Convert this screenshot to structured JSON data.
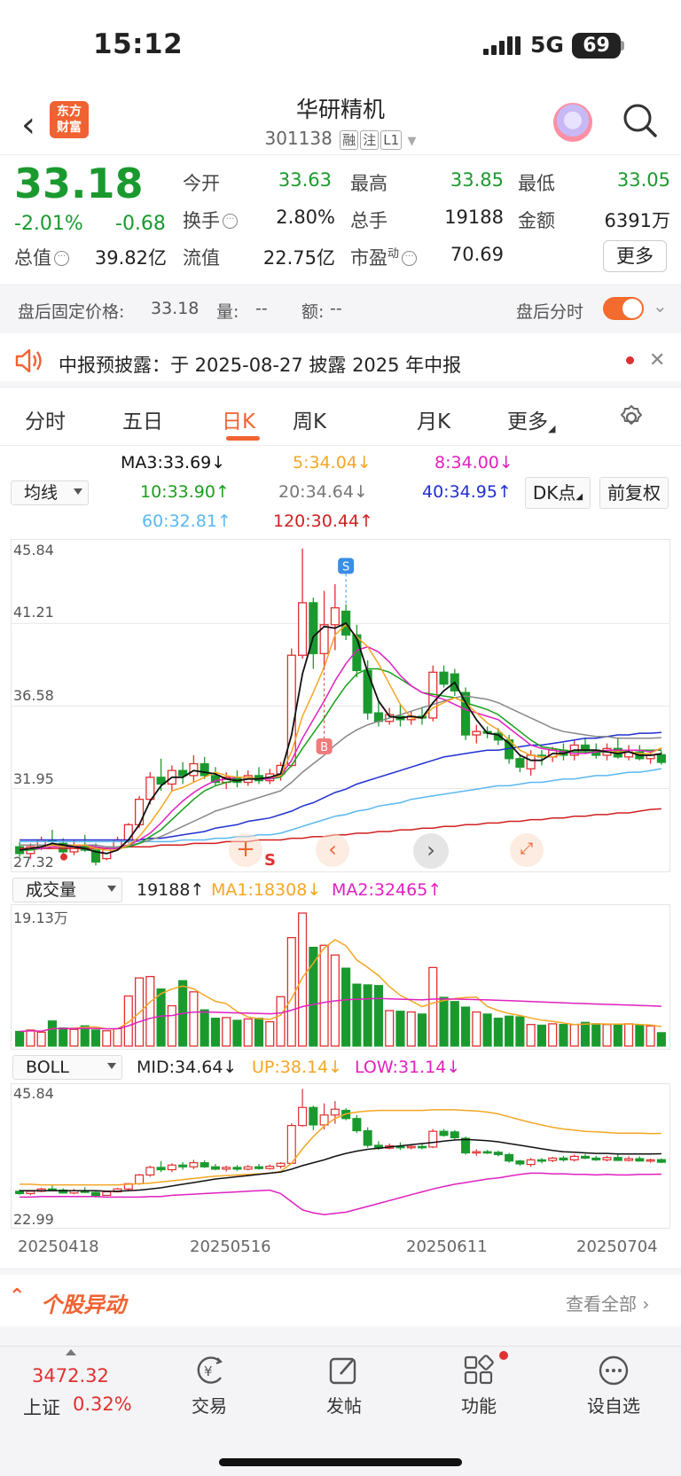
{
  "status_bar": {
    "time": "15:12",
    "network": "5G",
    "battery": "69"
  },
  "header": {
    "logo_text_1": "东方",
    "logo_text_2": "财富",
    "title": "华研精机",
    "code": "301138",
    "tags": [
      "融",
      "注",
      "L1"
    ]
  },
  "quote": {
    "price": "33.18",
    "change_pct": "-2.01%",
    "change": "-0.68",
    "open_label": "今开",
    "open": "33.63",
    "high_label": "最高",
    "high": "33.85",
    "low_label": "最低",
    "low": "33.05",
    "turnover_label": "换手",
    "turnover": "2.80%",
    "volume_label": "总手",
    "volume": "19188",
    "amount_label": "金额",
    "amount": "6391万",
    "mktcap_label": "总值",
    "mktcap": "39.82亿",
    "float_label": "流值",
    "float": "22.75亿",
    "pe_label": "市盈",
    "pe_sup": "动",
    "pe": "70.69",
    "more": "更多"
  },
  "after_hours": {
    "price_label": "盘后固定价格:",
    "price": "33.18",
    "vol_label": "量:",
    "vol": "--",
    "amt_label": "额:",
    "amt": "--",
    "toggle_label": "盘后分时",
    "toggle_on": true
  },
  "notice": {
    "text": "中报预披露：于 2025-08-27 披露 2025 年中报"
  },
  "tabs": [
    "分时",
    "五日",
    "日K",
    "周K",
    "月K",
    "更多"
  ],
  "active_tab": "日K",
  "ma_legend": {
    "selector": "均线",
    "ma3": "MA3:33.69",
    "ma5": "5:34.04",
    "ma8": "8:34.00",
    "ma10": "10:33.90",
    "ma20": "20:34.64",
    "ma40": "40:34.95",
    "ma60": "60:32.81",
    "ma120": "120:30.44",
    "dk_button": "DK点",
    "adjust_button": "前复权"
  },
  "price_axis": [
    "45.84",
    "41.21",
    "36.58",
    "31.95",
    "27.32"
  ],
  "volume_legend": {
    "selector": "成交量",
    "vol": "19188",
    "ma1": "MA1:18308",
    "ma2": "MA2:32465",
    "max": "19.13万"
  },
  "boll_legend": {
    "selector": "BOLL",
    "mid": "MID:34.64",
    "up": "UP:38.14",
    "low": "LOW:31.14",
    "top": "45.84",
    "bottom": "22.99"
  },
  "dates": [
    "20250418",
    "20250516",
    "20250611",
    "20250704"
  ],
  "markers": {
    "buy": "B",
    "sell": "S",
    "s_small": "S"
  },
  "stock_move": {
    "title": "个股异动",
    "see_all": "查看全部"
  },
  "bottom_nav": {
    "index_value": "3472.32",
    "index_name": "上证",
    "index_pct": "0.32%",
    "trade": "交易",
    "post": "发帖",
    "functions": "功能",
    "watchlist": "设自选"
  },
  "colors": {
    "up": "#e03030",
    "down": "#1a9a2e",
    "accent": "#f06232",
    "ma3": "#111111",
    "ma5": "#f5a623",
    "ma8": "#e020c0",
    "ma10": "#1aa01a",
    "ma20": "#888888",
    "ma40": "#2030d0",
    "ma60": "#5ab8f0",
    "ma120": "#d02020"
  },
  "chart_data": {
    "type": "candlestick",
    "title": "",
    "ylim": [
      27.32,
      45.84
    ],
    "x_ticks": [
      "20250418",
      "20250516",
      "20250611",
      "20250704"
    ],
    "candles": [
      [
        28.2,
        28.5,
        27.6,
        27.8
      ],
      [
        27.8,
        28.4,
        27.5,
        28.2
      ],
      [
        28.2,
        28.8,
        28.0,
        28.6
      ],
      [
        28.6,
        29.2,
        28.3,
        28.5
      ],
      [
        28.4,
        28.7,
        27.8,
        27.9
      ],
      [
        27.9,
        28.6,
        27.7,
        28.3
      ],
      [
        28.3,
        28.9,
        27.9,
        28.0
      ],
      [
        28.0,
        28.4,
        27.1,
        27.3
      ],
      [
        27.5,
        28.2,
        27.4,
        28.1
      ],
      [
        28.1,
        28.8,
        28.0,
        28.6
      ],
      [
        28.6,
        29.6,
        28.4,
        29.5
      ],
      [
        29.5,
        31.2,
        29.3,
        31.0
      ],
      [
        31.0,
        32.6,
        30.7,
        32.3
      ],
      [
        32.3,
        33.4,
        31.5,
        31.9
      ],
      [
        31.9,
        33.0,
        31.5,
        32.7
      ],
      [
        32.7,
        33.2,
        31.9,
        32.4
      ],
      [
        32.4,
        33.6,
        32.0,
        33.1
      ],
      [
        33.1,
        33.5,
        32.2,
        32.4
      ],
      [
        32.4,
        32.9,
        31.8,
        32.0
      ],
      [
        32.0,
        32.6,
        31.6,
        32.3
      ],
      [
        32.3,
        32.7,
        31.7,
        32.0
      ],
      [
        32.0,
        32.7,
        31.8,
        32.4
      ],
      [
        32.4,
        32.9,
        31.9,
        32.1
      ],
      [
        32.1,
        32.8,
        31.9,
        32.5
      ],
      [
        32.5,
        33.2,
        32.1,
        33.0
      ],
      [
        33.0,
        39.9,
        32.9,
        39.5
      ],
      [
        39.5,
        45.8,
        39.3,
        42.6
      ],
      [
        42.6,
        42.9,
        38.7,
        39.6
      ],
      [
        39.6,
        43.3,
        38.8,
        41.3
      ],
      [
        41.3,
        43.7,
        39.8,
        42.3
      ],
      [
        42.1,
        42.5,
        40.4,
        40.7
      ],
      [
        40.7,
        41.3,
        38.2,
        38.6
      ],
      [
        38.6,
        39.2,
        35.7,
        36.1
      ],
      [
        36.1,
        36.8,
        35.3,
        35.6
      ],
      [
        35.6,
        36.4,
        35.4,
        36.0
      ],
      [
        35.9,
        36.6,
        35.3,
        35.7
      ],
      [
        35.7,
        36.2,
        35.4,
        35.9
      ],
      [
        35.9,
        36.4,
        35.4,
        35.8
      ],
      [
        35.8,
        38.9,
        35.6,
        38.5
      ],
      [
        38.5,
        38.9,
        37.6,
        37.8
      ],
      [
        38.4,
        38.7,
        37.1,
        37.4
      ],
      [
        37.3,
        37.6,
        34.5,
        34.8
      ],
      [
        34.8,
        35.4,
        34.3,
        35.0
      ],
      [
        35.0,
        35.3,
        34.6,
        34.9
      ],
      [
        34.9,
        35.2,
        34.2,
        34.5
      ],
      [
        34.5,
        34.8,
        33.1,
        33.4
      ],
      [
        33.4,
        33.6,
        32.6,
        32.9
      ],
      [
        32.8,
        33.9,
        32.4,
        33.6
      ],
      [
        33.6,
        33.9,
        33.0,
        33.5
      ],
      [
        33.5,
        34.1,
        33.2,
        33.9
      ],
      [
        33.9,
        34.3,
        33.3,
        33.6
      ],
      [
        33.6,
        34.5,
        33.3,
        34.2
      ],
      [
        34.2,
        34.6,
        33.7,
        33.9
      ],
      [
        33.9,
        34.3,
        33.4,
        33.6
      ],
      [
        33.6,
        34.3,
        33.3,
        34.0
      ],
      [
        34.0,
        34.6,
        33.4,
        33.5
      ],
      [
        33.5,
        34.2,
        33.3,
        33.8
      ],
      [
        33.8,
        34.2,
        33.3,
        33.4
      ],
      [
        33.4,
        33.8,
        33.1,
        33.6
      ],
      [
        33.63,
        33.85,
        33.05,
        33.18
      ]
    ],
    "volumes": [
      2.1,
      2.3,
      2.0,
      3.6,
      2.6,
      2.4,
      2.9,
      2.3,
      2.2,
      2.5,
      7.2,
      9.8,
      10.0,
      8.2,
      5.8,
      9.4,
      7.8,
      5.2,
      4.0,
      4.1,
      3.7,
      3.9,
      4.0,
      3.5,
      7.1,
      15.6,
      19.13,
      14.2,
      14.5,
      13.1,
      11.2,
      8.9,
      8.8,
      8.7,
      5.1,
      5.0,
      4.9,
      4.6,
      11.3,
      7.0,
      6.4,
      5.6,
      4.9,
      4.6,
      4.0,
      4.3,
      4.2,
      3.1,
      3.0,
      3.2,
      3.1,
      3.1,
      3.4,
      3.2,
      3.1,
      3.0,
      3.2,
      3.0,
      2.9,
      1.92
    ],
    "ma_series": {
      "ma3": [
        28.0,
        28.1,
        28.2,
        28.4,
        28.3,
        28.2,
        28.1,
        27.9,
        27.8,
        28.0,
        28.6,
        29.5,
        30.9,
        31.8,
        32.3,
        32.3,
        32.7,
        32.6,
        32.5,
        32.2,
        32.1,
        32.2,
        32.2,
        32.3,
        32.5,
        34.8,
        38.4,
        40.6,
        41.2,
        41.1,
        41.4,
        40.5,
        38.5,
        36.8,
        35.9,
        35.8,
        35.9,
        35.8,
        36.7,
        37.4,
        37.9,
        36.7,
        35.7,
        34.9,
        34.8,
        34.3,
        33.6,
        33.3,
        33.3,
        33.7,
        33.7,
        33.9,
        33.9,
        33.9,
        33.8,
        33.7,
        33.8,
        33.6,
        33.6,
        33.69
      ],
      "ma5": [
        28.0,
        28.1,
        28.2,
        28.3,
        28.2,
        28.3,
        28.3,
        28.1,
        28.0,
        28.0,
        28.3,
        28.8,
        29.6,
        30.5,
        31.5,
        31.7,
        32.0,
        32.3,
        32.6,
        32.4,
        32.3,
        32.3,
        32.2,
        32.3,
        32.4,
        33.8,
        35.9,
        37.3,
        38.8,
        40.7,
        41.3,
        40.6,
        40.0,
        39.0,
        37.8,
        36.6,
        35.8,
        35.8,
        36.4,
        36.7,
        37.0,
        36.7,
        36.1,
        35.5,
        35.1,
        34.5,
        33.9,
        33.6,
        33.5,
        33.5,
        33.7,
        33.9,
        33.9,
        33.9,
        33.8,
        33.8,
        33.8,
        33.7,
        33.7,
        34.04
      ],
      "ma8": [
        28.0,
        28.1,
        28.1,
        28.2,
        28.2,
        28.2,
        28.3,
        28.2,
        28.1,
        28.1,
        28.3,
        28.6,
        29.0,
        29.6,
        30.3,
        30.9,
        31.4,
        31.8,
        32.1,
        32.2,
        32.3,
        32.3,
        32.2,
        32.2,
        32.4,
        33.3,
        34.6,
        35.7,
        36.8,
        38.0,
        39.0,
        39.8,
        40.0,
        39.7,
        39.1,
        38.3,
        37.7,
        37.3,
        37.1,
        36.9,
        36.6,
        36.3,
        36.1,
        35.9,
        35.7,
        35.2,
        34.7,
        34.2,
        34.0,
        33.9,
        33.8,
        33.7,
        33.7,
        33.8,
        33.9,
        33.9,
        33.9,
        33.9,
        33.8,
        34.0
      ],
      "ma10": [
        28.0,
        28.0,
        28.1,
        28.2,
        28.2,
        28.2,
        28.2,
        28.2,
        28.1,
        28.1,
        28.2,
        28.4,
        28.8,
        29.2,
        29.8,
        30.4,
        31.0,
        31.5,
        31.8,
        32.0,
        32.1,
        32.2,
        32.2,
        32.2,
        32.3,
        33.0,
        34.0,
        34.9,
        35.8,
        36.8,
        37.7,
        38.4,
        38.7,
        38.7,
        38.5,
        38.1,
        37.7,
        37.3,
        37.2,
        37.1,
        37.0,
        36.7,
        36.5,
        36.3,
        36.0,
        35.5,
        35.0,
        34.5,
        34.1,
        34.0,
        33.9,
        33.8,
        33.8,
        33.8,
        33.8,
        33.8,
        33.9,
        33.9,
        33.9,
        33.9
      ],
      "ma20": [
        28.3,
        28.3,
        28.3,
        28.3,
        28.3,
        28.3,
        28.3,
        28.3,
        28.2,
        28.2,
        28.3,
        28.4,
        28.6,
        28.8,
        29.1,
        29.4,
        29.7,
        30.0,
        30.3,
        30.5,
        30.7,
        30.9,
        31.1,
        31.3,
        31.5,
        32.0,
        32.6,
        33.1,
        33.6,
        34.2,
        34.7,
        35.1,
        35.4,
        35.6,
        35.8,
        36.0,
        36.2,
        36.4,
        36.6,
        36.8,
        37.0,
        37.1,
        37.0,
        36.9,
        36.7,
        36.4,
        36.1,
        35.8,
        35.5,
        35.2,
        35.0,
        34.9,
        34.8,
        34.7,
        34.7,
        34.6,
        34.6,
        34.6,
        34.6,
        34.64
      ],
      "ma40": [
        28.6,
        28.6,
        28.6,
        28.6,
        28.6,
        28.6,
        28.6,
        28.6,
        28.6,
        28.6,
        28.6,
        28.6,
        28.7,
        28.7,
        28.8,
        28.9,
        29.0,
        29.1,
        29.3,
        29.4,
        29.5,
        29.7,
        29.8,
        29.9,
        30.1,
        30.3,
        30.6,
        30.8,
        31.1,
        31.4,
        31.6,
        31.9,
        32.1,
        32.3,
        32.5,
        32.7,
        32.9,
        33.1,
        33.3,
        33.5,
        33.6,
        33.7,
        33.8,
        33.9,
        33.9,
        34.0,
        34.1,
        34.2,
        34.2,
        34.3,
        34.4,
        34.5,
        34.6,
        34.6,
        34.7,
        34.8,
        34.8,
        34.9,
        34.9,
        34.95
      ],
      "ma60": [
        28.5,
        28.5,
        28.5,
        28.5,
        28.5,
        28.5,
        28.5,
        28.5,
        28.5,
        28.5,
        28.5,
        28.5,
        28.5,
        28.5,
        28.5,
        28.6,
        28.6,
        28.6,
        28.7,
        28.7,
        28.8,
        28.8,
        28.9,
        28.9,
        29.0,
        29.2,
        29.4,
        29.6,
        29.8,
        30.0,
        30.1,
        30.3,
        30.4,
        30.6,
        30.7,
        30.8,
        31.0,
        31.1,
        31.2,
        31.3,
        31.4,
        31.5,
        31.6,
        31.7,
        31.8,
        31.8,
        31.9,
        32.0,
        32.0,
        32.1,
        32.2,
        32.2,
        32.3,
        32.4,
        32.4,
        32.5,
        32.6,
        32.6,
        32.7,
        32.81
      ],
      "ma120": [
        28.1,
        28.1,
        28.1,
        28.1,
        28.1,
        28.1,
        28.1,
        28.1,
        28.1,
        28.1,
        28.2,
        28.2,
        28.2,
        28.3,
        28.3,
        28.3,
        28.4,
        28.4,
        28.4,
        28.5,
        28.5,
        28.5,
        28.6,
        28.6,
        28.6,
        28.7,
        28.7,
        28.8,
        28.8,
        28.9,
        28.9,
        29.0,
        29.0,
        29.1,
        29.1,
        29.2,
        29.2,
        29.3,
        29.3,
        29.4,
        29.4,
        29.5,
        29.5,
        29.6,
        29.6,
        29.7,
        29.7,
        29.8,
        29.8,
        29.9,
        29.9,
        30.0,
        30.0,
        30.1,
        30.1,
        30.2,
        30.2,
        30.3,
        30.4,
        30.44
      ]
    },
    "volume_ma1_ref": "18308",
    "volume_ma2_ref": "32465",
    "boll_ylim": [
      22.99,
      45.84
    ],
    "boll": {
      "up": [
        29.4,
        29.4,
        29.3,
        29.3,
        29.3,
        29.3,
        29.3,
        29.3,
        29.3,
        29.3,
        29.4,
        29.5,
        29.6,
        29.8,
        30.0,
        30.2,
        30.4,
        30.6,
        30.8,
        30.9,
        31.0,
        31.1,
        31.2,
        31.3,
        31.6,
        33.0,
        35.5,
        37.6,
        39.4,
        40.7,
        41.5,
        41.8,
        42.0,
        42.1,
        42.1,
        42.1,
        42.1,
        42.1,
        42.2,
        42.2,
        42.2,
        42.1,
        42.0,
        41.8,
        41.5,
        41.0,
        40.5,
        40.0,
        39.6,
        39.2,
        38.9,
        38.7,
        38.5,
        38.4,
        38.3,
        38.2,
        38.2,
        38.2,
        38.1,
        38.14
      ],
      "mid": [
        28.3,
        28.3,
        28.3,
        28.3,
        28.3,
        28.3,
        28.3,
        28.3,
        28.2,
        28.2,
        28.3,
        28.4,
        28.6,
        28.8,
        29.1,
        29.4,
        29.7,
        30.0,
        30.3,
        30.5,
        30.7,
        30.9,
        31.1,
        31.3,
        31.5,
        32.0,
        32.6,
        33.1,
        33.6,
        34.2,
        34.7,
        35.1,
        35.4,
        35.6,
        35.8,
        36.0,
        36.2,
        36.4,
        36.6,
        36.8,
        37.0,
        37.1,
        37.0,
        36.9,
        36.7,
        36.4,
        36.1,
        35.8,
        35.5,
        35.2,
        35.0,
        34.9,
        34.8,
        34.7,
        34.7,
        34.6,
        34.6,
        34.6,
        34.6,
        34.64
      ],
      "low": [
        27.2,
        27.2,
        27.3,
        27.3,
        27.3,
        27.3,
        27.3,
        27.3,
        27.2,
        27.2,
        27.2,
        27.2,
        27.3,
        27.3,
        27.5,
        27.6,
        27.7,
        27.8,
        27.9,
        28.0,
        28.1,
        28.2,
        28.3,
        28.4,
        27.8,
        26.4,
        25.0,
        24.5,
        24.2,
        24.4,
        24.6,
        25.1,
        25.6,
        26.1,
        26.6,
        27.1,
        27.6,
        28.1,
        28.6,
        29.0,
        29.4,
        29.7,
        30.0,
        30.3,
        30.5,
        30.8,
        31.1,
        31.3,
        31.3,
        31.2,
        31.2,
        31.1,
        31.1,
        31.0,
        31.1,
        31.0,
        31.0,
        31.1,
        31.1,
        31.14
      ]
    }
  }
}
